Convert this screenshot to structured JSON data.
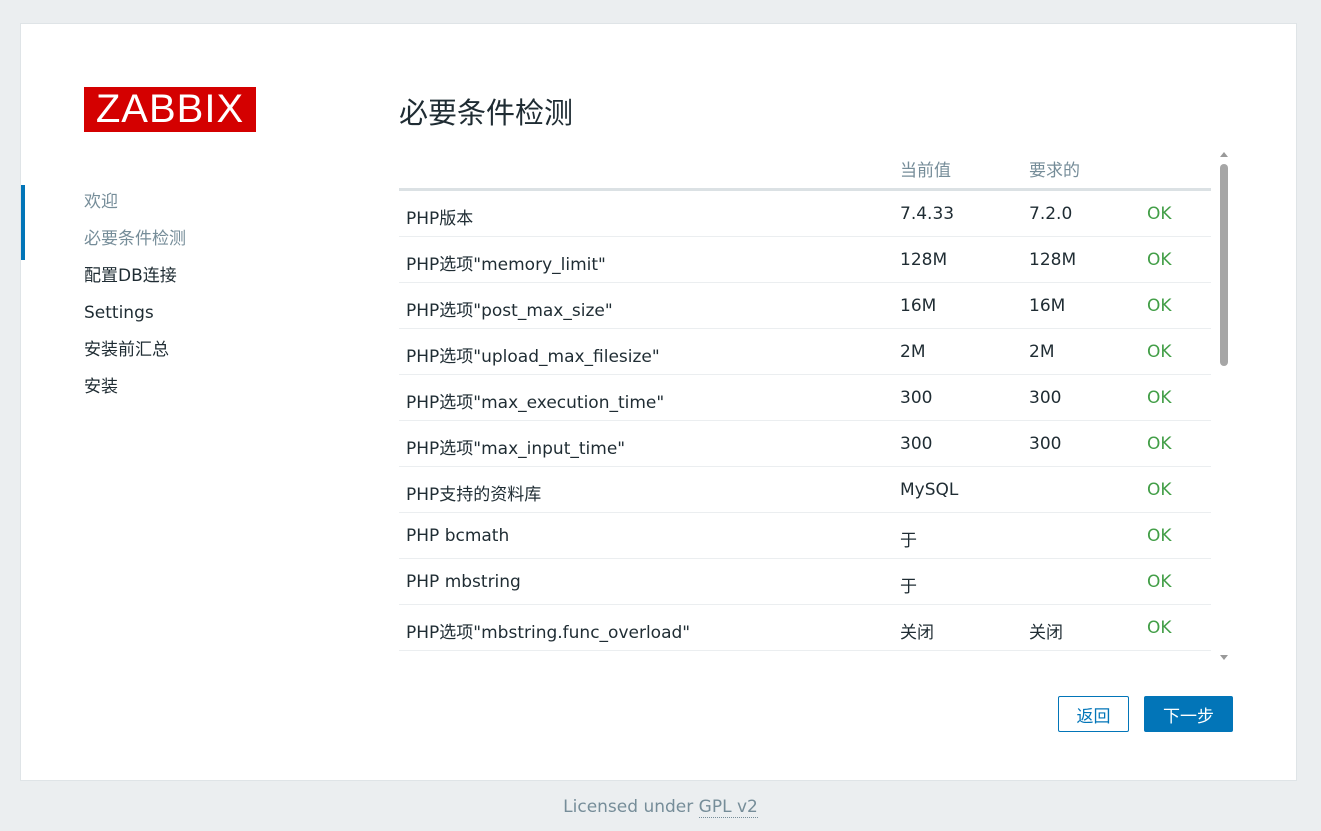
{
  "logo": {
    "text": "ZABBIX",
    "color": "#d40000"
  },
  "nav": {
    "items": [
      {
        "label": "欢迎",
        "state": "done"
      },
      {
        "label": "必要条件检测",
        "state": "current"
      },
      {
        "label": "配置DB连接",
        "state": "pending"
      },
      {
        "label": "Settings",
        "state": "pending"
      },
      {
        "label": "安装前汇总",
        "state": "pending"
      },
      {
        "label": "安装",
        "state": "pending"
      }
    ]
  },
  "page": {
    "title": "必要条件检测"
  },
  "table": {
    "headers": {
      "current": "当前值",
      "required": "要求的"
    },
    "rows": [
      {
        "name": "PHP版本",
        "current": "7.4.33",
        "required": "7.2.0",
        "status": "OK"
      },
      {
        "name": "PHP选项\"memory_limit\"",
        "current": "128M",
        "required": "128M",
        "status": "OK"
      },
      {
        "name": "PHP选项\"post_max_size\"",
        "current": "16M",
        "required": "16M",
        "status": "OK"
      },
      {
        "name": "PHP选项\"upload_max_filesize\"",
        "current": "2M",
        "required": "2M",
        "status": "OK"
      },
      {
        "name": "PHP选项\"max_execution_time\"",
        "current": "300",
        "required": "300",
        "status": "OK"
      },
      {
        "name": "PHP选项\"max_input_time\"",
        "current": "300",
        "required": "300",
        "status": "OK"
      },
      {
        "name": "PHP支持的资料库",
        "current": "MySQL",
        "required": "",
        "status": "OK"
      },
      {
        "name": "PHP bcmath",
        "current": "于",
        "required": "",
        "status": "OK"
      },
      {
        "name": "PHP mbstring",
        "current": "于",
        "required": "",
        "status": "OK"
      },
      {
        "name": "PHP选项\"mbstring.func_overload\"",
        "current": "关闭",
        "required": "关闭",
        "status": "OK"
      }
    ]
  },
  "buttons": {
    "back": "返回",
    "next": "下一步"
  },
  "footer": {
    "prefix": "Licensed under ",
    "link": "GPL v2"
  },
  "colors": {
    "accent": "#0275b8",
    "ok": "#429e47",
    "muted": "#768d99"
  }
}
